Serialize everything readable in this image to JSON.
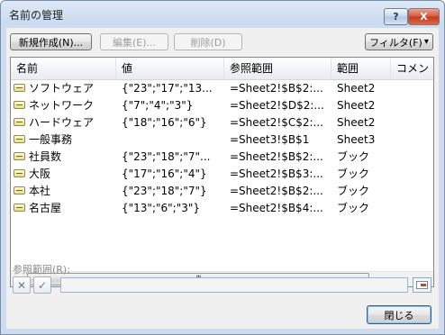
{
  "window": {
    "title": "名前の管理",
    "help_label": "?",
    "close_label": "X"
  },
  "toolbar": {
    "new_label": "新規作成(N)...",
    "edit_label": "編集(E)...",
    "delete_label": "削除(D)",
    "filter_label": "フィルタ(F)",
    "filter_arrow": "▾"
  },
  "list": {
    "columns": [
      "名前",
      "値",
      "参照範囲",
      "範囲",
      "コメン"
    ],
    "rows": [
      {
        "name": "ソフトウェア",
        "value": "{\"23\";\"17\";\"13...",
        "ref": "=Sheet2!$B$2:...",
        "scope": "Sheet2"
      },
      {
        "name": "ネットワーク",
        "value": "{\"7\";\"4\";\"3\"}",
        "ref": "=Sheet2!$D$2:...",
        "scope": "Sheet2"
      },
      {
        "name": "ハードウェア",
        "value": "{\"18\";\"16\";\"6\"}",
        "ref": "=Sheet2!$C$2:...",
        "scope": "Sheet2"
      },
      {
        "name": "一般事務",
        "value": "",
        "ref": "=Sheet3!$B$1",
        "scope": "Sheet3"
      },
      {
        "name": "社員数",
        "value": "{\"23\";\"18\";\"7\"...",
        "ref": "=Sheet2!$B$2:...",
        "scope": "ブック"
      },
      {
        "name": "大阪",
        "value": "{\"17\";\"16\";\"4\"}",
        "ref": "=Sheet2!$B$3:...",
        "scope": "ブック"
      },
      {
        "name": "本社",
        "value": "{\"23\";\"18\";\"7\"}",
        "ref": "=Sheet2!$B$2:...",
        "scope": "ブック"
      },
      {
        "name": "名古屋",
        "value": "{\"13\";\"6\";\"3\"}",
        "ref": "=Sheet2!$B$4:...",
        "scope": "ブック"
      }
    ],
    "scroll_left": "◀",
    "scroll_right": "▶",
    "scroll_grip": "III"
  },
  "reference": {
    "label": "参照範囲(R):",
    "value": "",
    "cancel_glyph": "✕",
    "confirm_glyph": "✓"
  },
  "footer": {
    "close_label": "閉じる"
  }
}
